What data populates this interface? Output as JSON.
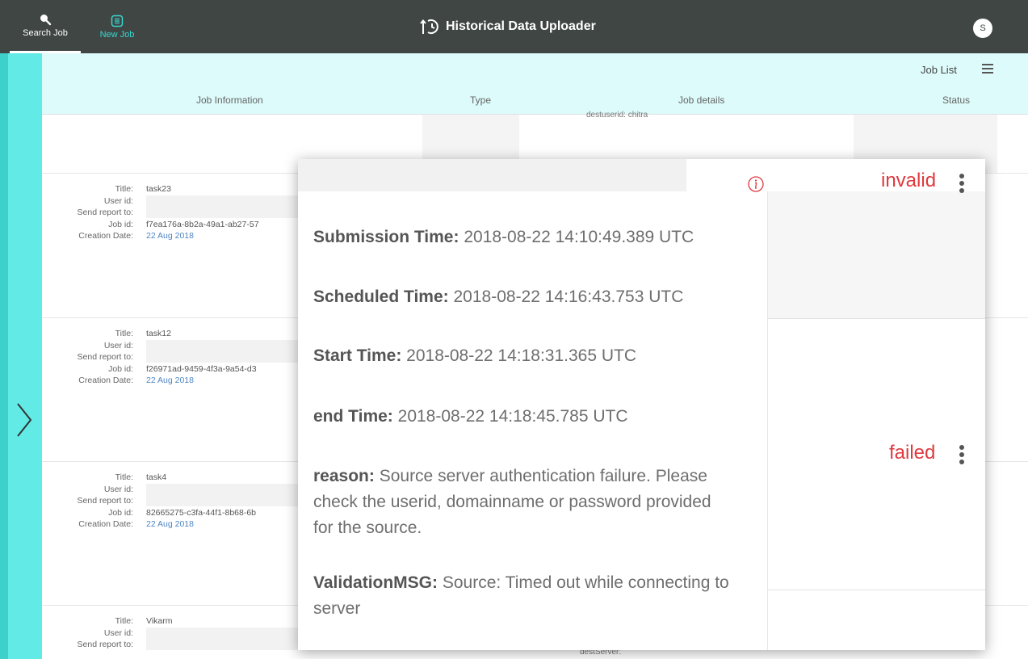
{
  "nav": {
    "search_label": "Search Job",
    "new_label": "New Job",
    "app_title": "Historical Data Uploader",
    "avatar_initial": "S"
  },
  "list": {
    "title": "Job List",
    "columns": [
      "Job Information",
      "Type",
      "Job details",
      "Status"
    ]
  },
  "partial_top": {
    "detail_label": "destuserid:",
    "detail_value": "chitra"
  },
  "rows": [
    {
      "title_label": "Title:",
      "title": "task23",
      "userid_label": "User id:",
      "report_label": "Send report to:",
      "jobid_label": "Job id:",
      "jobid": "f7ea176a-8b2a-49a1-ab27-57",
      "date_label": "Creation Date:",
      "date": "22 Aug 2018",
      "status": "invalid"
    },
    {
      "title_label": "Title:",
      "title": "task12",
      "userid_label": "User id:",
      "report_label": "Send report to:",
      "jobid_label": "Job id:",
      "jobid": "f26971ad-9459-4f3a-9a54-d3",
      "date_label": "Creation Date:",
      "date": "22 Aug 2018"
    },
    {
      "title_label": "Title:",
      "title": "task4",
      "userid_label": "User id:",
      "report_label": "Send report to:",
      "jobid_label": "Job id:",
      "jobid": "82665275-c3fa-44f1-8b68-6b",
      "date_label": "Creation Date:",
      "date": "22 Aug 2018",
      "status": "failed"
    },
    {
      "title_label": "Title:",
      "title": "Vikarm",
      "userid_label": "User id:",
      "report_label": "Send report to:",
      "detail_label": "destServer:"
    }
  ],
  "popup": {
    "submission_label": "Submission Time:",
    "submission": "2018-08-22 14:10:49.389 UTC",
    "scheduled_label": "Scheduled Time:",
    "scheduled": "2018-08-22 14:16:43.753 UTC",
    "start_label": "Start Time:",
    "start": "2018-08-22 14:18:31.365 UTC",
    "end_label": "end Time:",
    "end": "2018-08-22 14:18:45.785 UTC",
    "reason_label": "reason:",
    "reason": "Source server authentication failure. Please check the userid, domainname or password provided for the source.",
    "validation_label": "ValidationMSG:",
    "validation": "Source: Timed out while connecting to server"
  },
  "colors": {
    "topbar": "#404644",
    "accent": "#38d7d1",
    "rail": "#61eae6",
    "header_bg": "#dcfbfa",
    "status_red": "#e0393e",
    "date_link": "#4f86c4"
  }
}
